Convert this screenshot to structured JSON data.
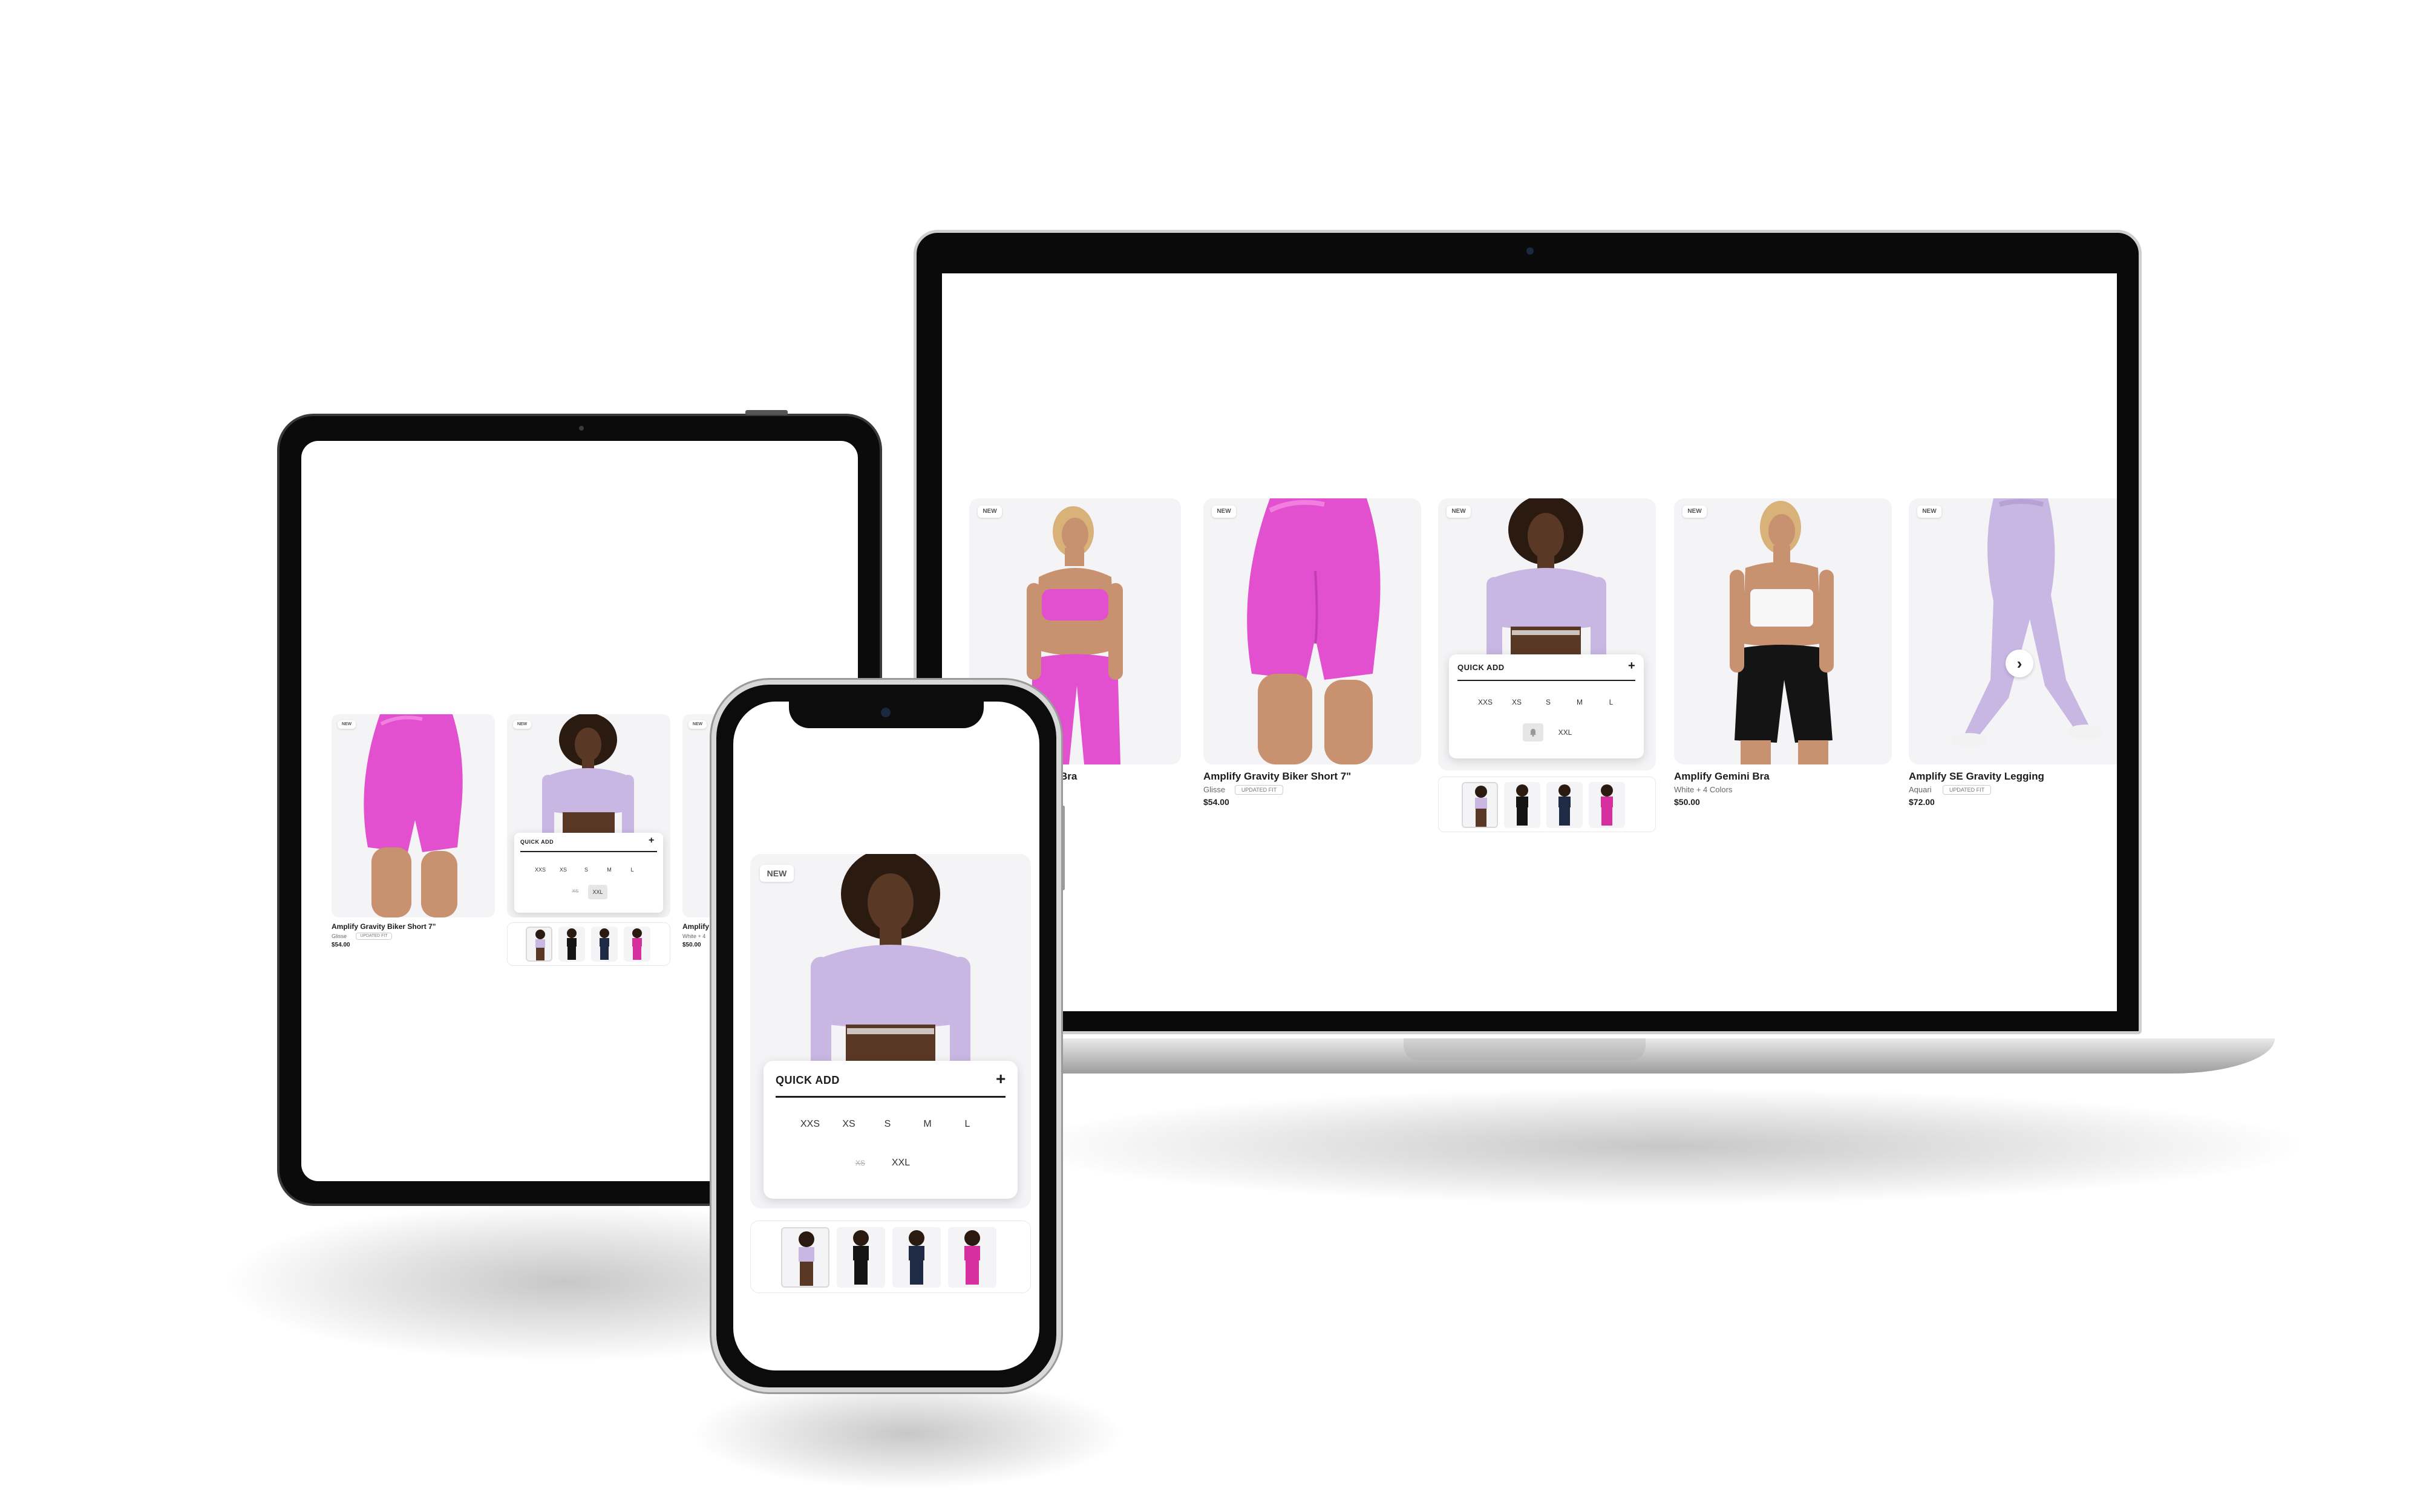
{
  "colors": {
    "pink": "#e24fcf",
    "lavender": "#c9b7e3",
    "black": "#141414",
    "navy": "#1f2a44",
    "magenta": "#d6309f",
    "skin": "#b98362",
    "dark_skin": "#5a3826",
    "white_top": "#f7f7f7"
  },
  "laptop": {
    "cards": [
      {
        "badge": "NEW",
        "title": "Bra",
        "product": "pink-set",
        "type": "plain"
      },
      {
        "badge": "NEW",
        "title": "Amplify Gravity Biker Short 7\"",
        "color": "Glisse",
        "fit": "UPDATED FIT",
        "price": "$54.00",
        "product": "pink-shorts"
      },
      {
        "badge": "NEW",
        "product": "lavender-top",
        "quick_add": {
          "title": "QUICK ADD",
          "plus": "+",
          "sizes": [
            "XXS",
            "XS",
            "S",
            "M",
            "L"
          ],
          "sizes2": [
            "XXL"
          ]
        },
        "thumbs": [
          "lavender",
          "black",
          "navy",
          "magenta"
        ]
      },
      {
        "badge": "NEW",
        "title": "Amplify Gemini Bra",
        "color": "White + 4 Colors",
        "price": "$50.00",
        "product": "white-top-black-shorts"
      },
      {
        "badge": "NEW",
        "title": "Amplify SE Gravity Legging",
        "color": "Aquari",
        "fit": "UPDATED FIT",
        "price": "$72.00",
        "product": "lavender-legging",
        "next": "›"
      }
    ]
  },
  "tablet": {
    "cards": [
      {
        "badge": "NEW",
        "title": "Amplify Gravity Biker Short 7\"",
        "color": "Glisse",
        "fit": "UPDATED FIT",
        "price": "$54.00"
      },
      {
        "badge": "NEW",
        "quick_add": {
          "title": "QUICK ADD",
          "plus": "+",
          "sizes": [
            "XXS",
            "XS",
            "S",
            "M",
            "L"
          ],
          "sizes2": [
            "XS",
            "XXL"
          ]
        }
      },
      {
        "badge": "NEW",
        "title": "Amplify",
        "color": "White + 4",
        "price": "$50.00"
      }
    ]
  },
  "phone": {
    "badge": "NEW",
    "quick_add": {
      "title": "QUICK ADD",
      "plus": "+",
      "sizes": [
        "XXS",
        "XS",
        "S",
        "M",
        "L"
      ],
      "sizes2": [
        "XS",
        "XXL"
      ]
    }
  }
}
